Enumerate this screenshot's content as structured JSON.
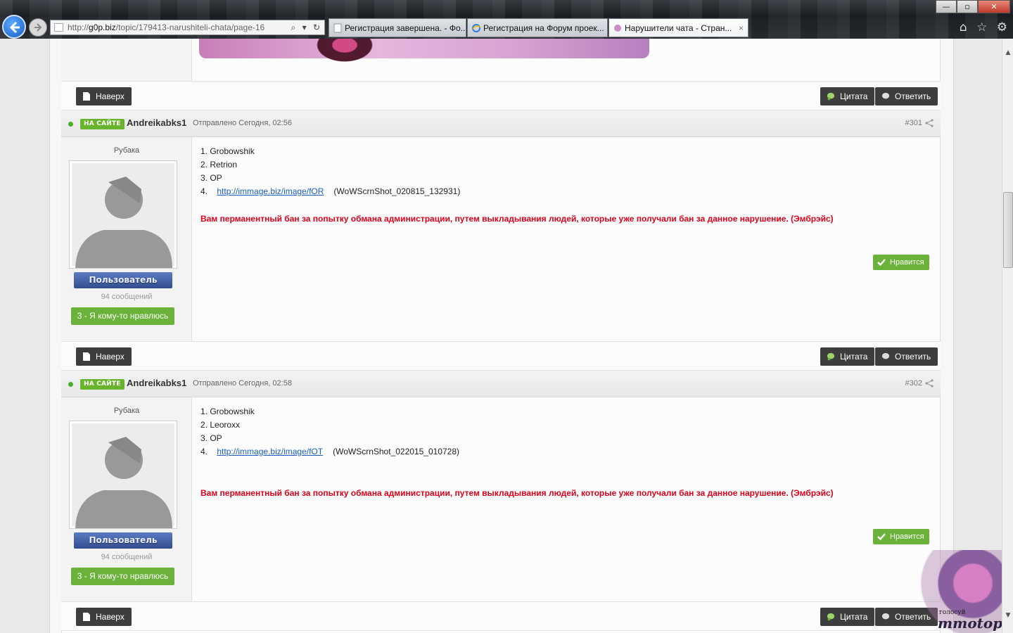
{
  "browser": {
    "url_prefix": "http://",
    "url_host": "g0p.biz",
    "url_path": "/topic/179413-narushiteli-chata/page-16",
    "tabs": [
      {
        "title": "Регистрация завершена. - Фо..."
      },
      {
        "title": "Регистрация на Форум проек..."
      },
      {
        "title": "Нарушители чата - Стран...",
        "close": "×"
      }
    ],
    "window_buttons": {
      "minimize": "—",
      "maximize": "▫",
      "close": "✕"
    },
    "toolbar_icons": [
      "home-icon",
      "favorites-star-icon",
      "settings-gear-icon"
    ]
  },
  "colors": {
    "accent_green": "#6ab23a",
    "ban_red": "#e0001a",
    "link_blue": "#1a5fbf",
    "dark_button": "#3d3d3d",
    "group_badge": "#3f5ca6"
  },
  "buttons": {
    "top": "Наверх",
    "quote": "Цитата",
    "reply": "Ответить",
    "like": "Нравится"
  },
  "posts": [
    {
      "online_badge": "НА САЙТЕ",
      "author": "Andreikabks1",
      "posted": "Отправлено Сегодня, 02:56",
      "number": "#301",
      "rank_title": "Рубака",
      "group": "Пользователь",
      "post_count": "94 сообщений",
      "reputation": "3 - Я кому-то нравлюсь",
      "lines": [
        "1. Grobowshik",
        "2. Retrion",
        "3. OP"
      ],
      "item4_num": "4.",
      "item4_link": "http://immage.biz/image/fOR",
      "item4_file": "(WoWScrnShot_020815_132931)",
      "ban_message": "Вам перманентный бан за попытку обмана администрации, путем выкладывания людей, которые уже получали бан за данное нарушение. (Эмбрэйс)"
    },
    {
      "online_badge": "НА САЙТЕ",
      "author": "Andreikabks1",
      "posted": "Отправлено Сегодня, 02:58",
      "number": "#302",
      "rank_title": "Рубака",
      "group": "Пользователь",
      "post_count": "94 сообщений",
      "reputation": "3 - Я кому-то нравлюсь",
      "lines": [
        "1. Grobowshik",
        "2. Leoroxx",
        "3. OP"
      ],
      "item4_num": "4.",
      "item4_link": "http://immage.biz/image/fOT",
      "item4_file": "(WoWScrnShot_022015_010728)",
      "ban_message": "Вам перманентный бан за попытку обмана администрации, путем выкладывания людей, которые уже получали бан за данное нарушение. (Эмбрэйс)"
    }
  ],
  "widget": {
    "caption": "голосуй",
    "logo": "mmotop"
  }
}
